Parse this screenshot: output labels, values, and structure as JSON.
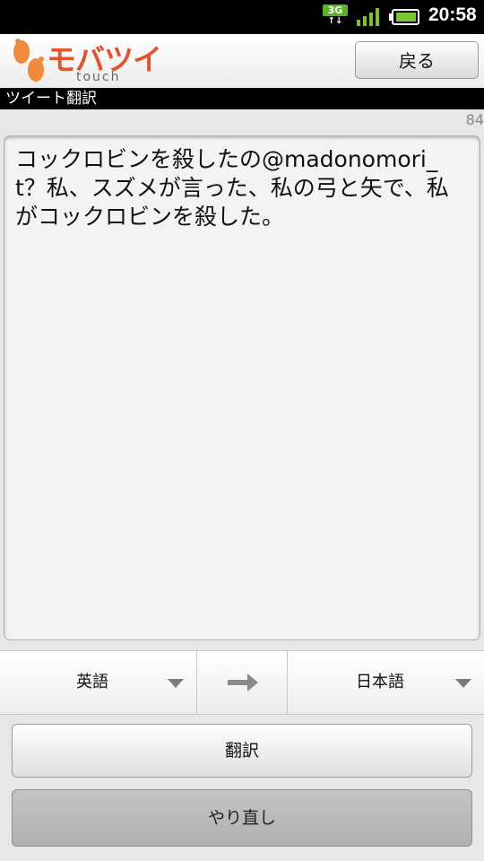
{
  "status_bar": {
    "network_label": "3G",
    "network_arrows": "↑↓",
    "time": "20:58",
    "icons": [
      "3g-icon",
      "signal-icon",
      "battery-icon"
    ]
  },
  "header": {
    "logo_text": "モバツイ",
    "logo_sub": "touch",
    "back_label": "戻る",
    "brand_color": "#e0552d"
  },
  "title_bar": {
    "title": "ツイート翻訳"
  },
  "editor": {
    "char_count": "84",
    "text": "コックロビンを殺したの@madonomori_t？私、スズメが言った、私の弓と矢で、私がコックロビンを殺した。"
  },
  "languages": {
    "source": "英語",
    "target": "日本語",
    "swap_icon": "arrow-right-icon"
  },
  "actions": {
    "translate_label": "翻訳",
    "redo_label": "やり直し"
  }
}
